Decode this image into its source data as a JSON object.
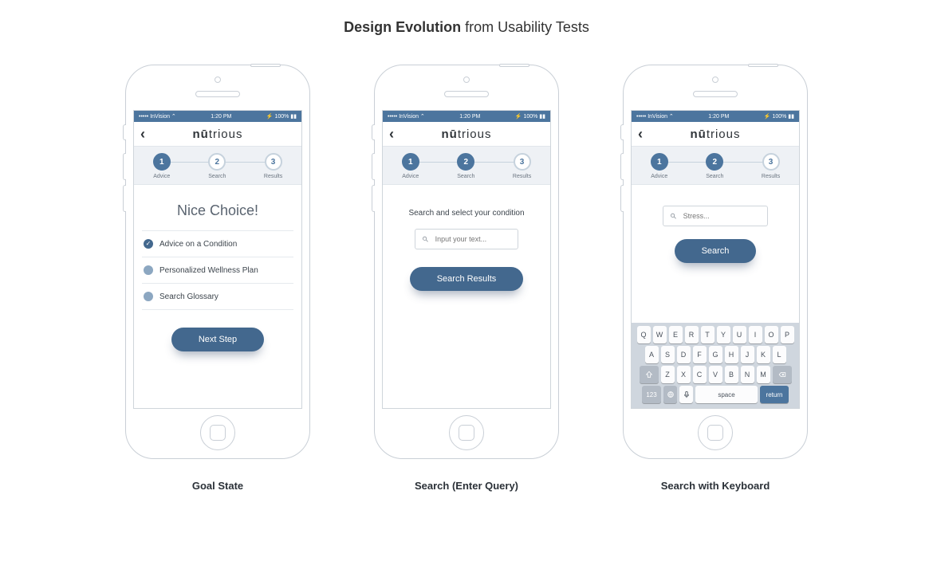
{
  "page_title": {
    "bold": "Design Evolution",
    "rest": " from Usability Tests"
  },
  "logo": {
    "bold": "nū",
    "rest": "trious"
  },
  "status": {
    "carrier": "••••• InVision ⌃",
    "time": "1:20 PM",
    "right": "⚡ 100% ▮▮"
  },
  "steps": [
    {
      "n": "1",
      "label": "Advice"
    },
    {
      "n": "2",
      "label": "Search"
    },
    {
      "n": "3",
      "label": "Results"
    }
  ],
  "phone1": {
    "caption": "Goal State",
    "headline": "Nice Choice!",
    "options": [
      {
        "label": "Advice on a Condition",
        "selected": true
      },
      {
        "label": "Personalized Wellness Plan",
        "selected": false
      },
      {
        "label": "Search Glossary",
        "selected": false
      }
    ],
    "cta": "Next Step",
    "active_step": 0
  },
  "phone2": {
    "caption": "Search (Enter Query)",
    "prompt": "Search and select your condition",
    "placeholder": "Input your text...",
    "cta": "Search Results",
    "active_step": 1
  },
  "phone3": {
    "caption": "Search with Keyboard",
    "placeholder": "Stress...",
    "cta": "Search",
    "active_step": 1
  },
  "keyboard": {
    "row1": [
      "Q",
      "W",
      "E",
      "R",
      "T",
      "Y",
      "U",
      "I",
      "O",
      "P"
    ],
    "row2": [
      "A",
      "S",
      "D",
      "F",
      "G",
      "H",
      "J",
      "K",
      "L"
    ],
    "row3": [
      "Z",
      "X",
      "C",
      "V",
      "B",
      "N",
      "M"
    ],
    "num": "123",
    "space": "space",
    "return": "return"
  }
}
